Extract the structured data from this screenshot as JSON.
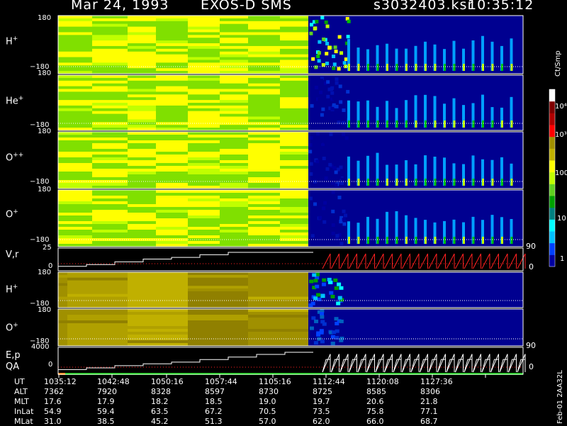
{
  "header": {
    "date": "Mar 24, 1993",
    "instrument": "EXOS-D SMS",
    "file": "s3032403.ksr",
    "time": "10:35:12"
  },
  "footer_note": "Feb-01 2AA32L",
  "colors": {
    "background": "#000000",
    "text": "#ffffff",
    "trace_red": "#ff2020"
  },
  "chart_data": {
    "type": "heatmap",
    "panels": [
      {
        "label": "H",
        "charge": "+",
        "ylim": [
          -180,
          180
        ],
        "tick_top": "180",
        "tick_bottom": "−180"
      },
      {
        "label": "He",
        "charge": "+",
        "ylim": [
          -180,
          180
        ],
        "tick_top": "180",
        "tick_bottom": "−180"
      },
      {
        "label": "O",
        "charge": "++",
        "ylim": [
          -180,
          180
        ],
        "tick_top": "180",
        "tick_bottom": "−180"
      },
      {
        "label": "O",
        "charge": "+",
        "ylim": [
          -180,
          180
        ],
        "tick_top": "180",
        "tick_bottom": "−180",
        "right_tick": "90"
      },
      {
        "label": "V,r",
        "ylim": [
          0,
          25
        ],
        "tick_top": "25",
        "tick_bottom": "0",
        "right_tick": "0"
      },
      {
        "label": "H",
        "charge": "+",
        "ylim": [
          -180,
          180
        ],
        "tick_top": "180",
        "tick_bottom": "−180"
      },
      {
        "label": "O",
        "charge": "+",
        "ylim": [
          -180,
          180
        ],
        "tick_top": "180",
        "tick_bottom": "−180",
        "right_tick": "90"
      },
      {
        "label": "E,p",
        "label2": "QA",
        "ylim": [
          0,
          4000
        ],
        "tick_top": "4000",
        "tick_bottom": "0",
        "right_tick": "0"
      }
    ],
    "colorbar": {
      "unit": "Ct/Smp",
      "scale": "log",
      "range": [
        1,
        10000
      ],
      "labels": [
        "1",
        "10",
        "100",
        "10³",
        "10⁴"
      ],
      "colors": [
        "#0000a0",
        "#0040ff",
        "#00c0ff",
        "#00ffff",
        "#008080",
        "#00a000",
        "#60d020",
        "#c0ff00",
        "#ffff00",
        "#c0b000",
        "#a09000",
        "#ff0000",
        "#b00000",
        "#800000",
        "#ffffff"
      ]
    },
    "time_axis": {
      "rows": [
        {
          "name": "UT",
          "values": [
            "1035:12",
            "1042:48",
            "1050:16",
            "1057:44",
            "1105:16",
            "1112:44",
            "1120:08",
            "1127:36"
          ]
        },
        {
          "name": "ALT",
          "values": [
            "7362",
            "7920",
            "8328",
            "8597",
            "8730",
            "8725",
            "8585",
            "8306"
          ]
        },
        {
          "name": "MLT",
          "values": [
            "17.6",
            "17.9",
            "18.2",
            "18.5",
            "19.0",
            "19.7",
            "20.6",
            "21.8"
          ]
        },
        {
          "name": "InLat",
          "values": [
            "54.9",
            "59.4",
            "63.5",
            "67.2",
            "70.5",
            "73.5",
            "75.8",
            "77.1"
          ]
        },
        {
          "name": "MLat",
          "values": [
            "31.0",
            "38.5",
            "45.2",
            "51.3",
            "57.0",
            "62.0",
            "66.0",
            "68.7"
          ]
        }
      ]
    }
  }
}
